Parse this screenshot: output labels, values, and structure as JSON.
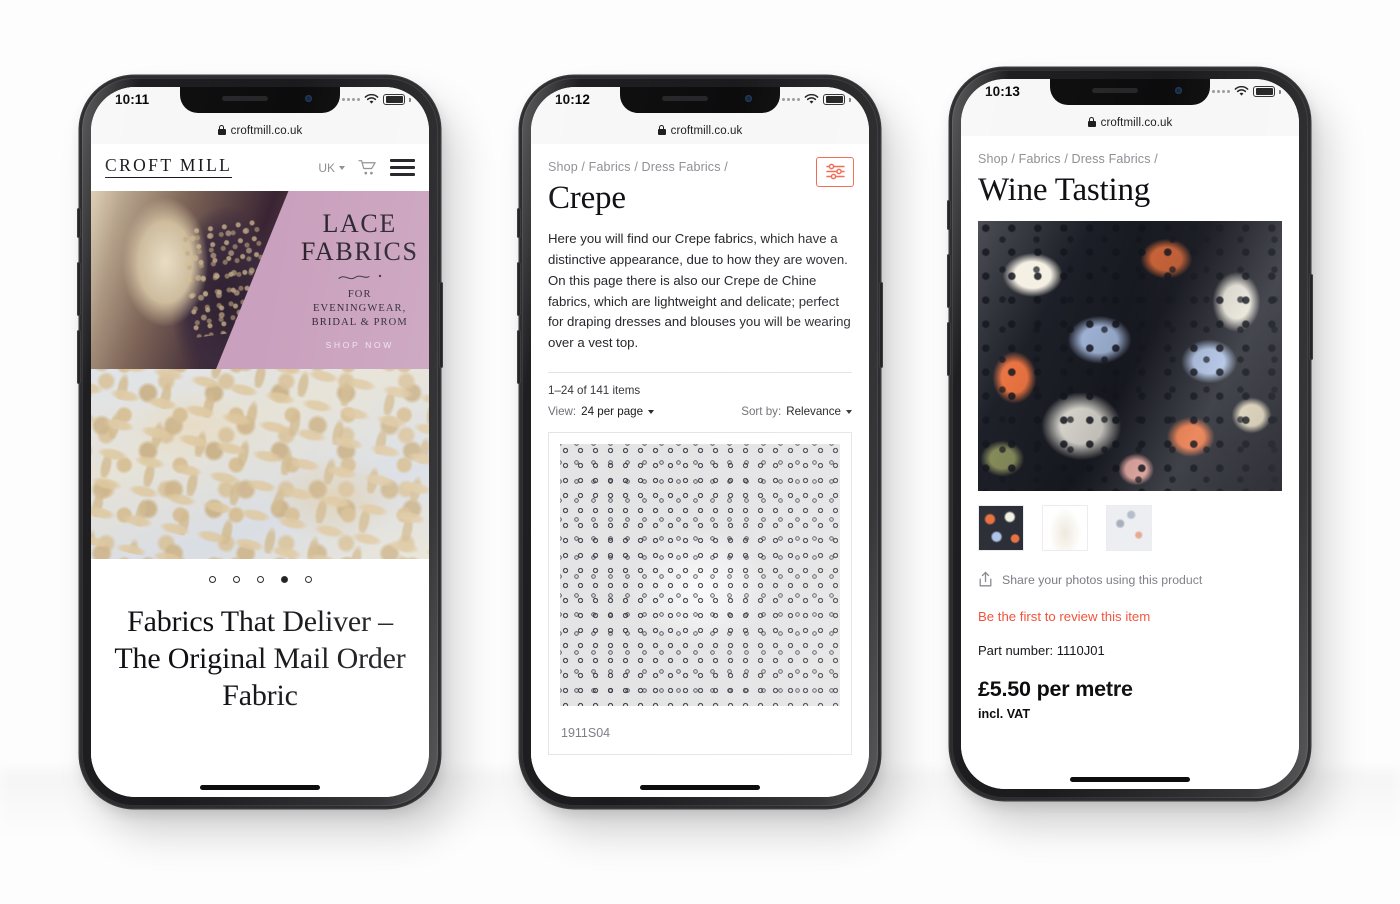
{
  "brand": {
    "name_primary": "CROFT",
    "name_secondary": "MILL",
    "host": "croftmill.co.uk"
  },
  "phones": [
    {
      "id": "phone-home",
      "status": {
        "time": "10:11"
      },
      "url": "croftmill.co.uk",
      "header": {
        "logo_first": "CROFT",
        "logo_second": "MILL",
        "region": "UK",
        "cart_icon": "cart-icon",
        "menu_icon": "hamburger-menu-icon"
      },
      "hero": {
        "title_line1": "LACE",
        "title_line2": "FABRICS",
        "sub_line1": "FOR",
        "sub_line2": "EVENINGWEAR,",
        "sub_line3": "BRIDAL & PROM",
        "cta": "SHOP NOW",
        "panel_color": "#c9a0bd"
      },
      "carousel": {
        "total": 5,
        "active_index": 3
      },
      "tagline": "Fabrics That Deliver – The Original Mail Order Fabric"
    },
    {
      "id": "phone-category",
      "status": {
        "time": "10:12"
      },
      "url": "croftmill.co.uk",
      "breadcrumb": "Shop / Fabrics / Dress Fabrics /",
      "filter_icon": "filter-sliders-icon",
      "filter_color": "#f1654a",
      "title": "Crepe",
      "description": "Here you will find our Crepe fabrics, which have a distinctive appearance, due to how they are woven. On this page there is also our Crepe de Chine fabrics, which are lightweight and delicate; perfect for draping dresses and blouses you will be wearing over a vest top.",
      "results_count": "1–24 of 141 items",
      "view_label": "View:",
      "view_value": "24 per page",
      "sort_label": "Sort by:",
      "sort_value": "Relevance",
      "product": {
        "code": "1911S04"
      }
    },
    {
      "id": "phone-product",
      "status": {
        "time": "10:13"
      },
      "url": "croftmill.co.uk",
      "breadcrumb": "Shop / Fabrics / Dress Fabrics /",
      "title": "Wine Tasting",
      "thumbnails": [
        "thumbnail-floral-print",
        "thumbnail-draped-fabric",
        "thumbnail-swirl-texture"
      ],
      "share_text": "Share your photos using this product",
      "share_icon": "share-upload-icon",
      "review_link": "Be the first to review this item",
      "review_color": "#f0533a",
      "part_number": "Part number: 1110J01",
      "price": "£5.50 per metre",
      "vat_note": "incl. VAT"
    }
  ]
}
